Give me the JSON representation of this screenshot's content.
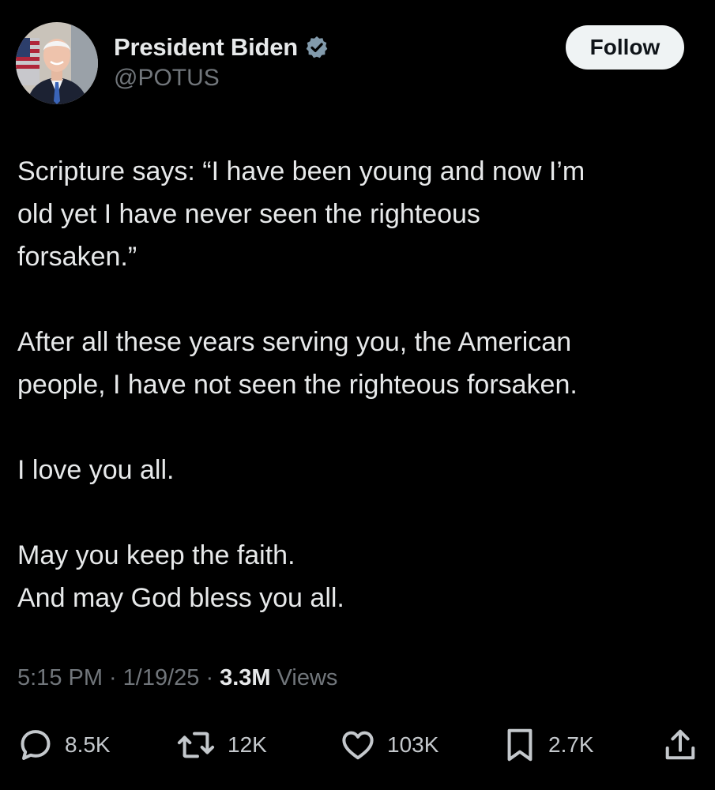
{
  "author": {
    "display_name": "President Biden",
    "handle": "@POTUS",
    "verified": true,
    "verified_color": "#71767b",
    "avatar_icon": "portrait-avatar"
  },
  "follow_label": "Follow",
  "body": {
    "paragraphs": [
      "Scripture says: “I have been young and now I’m\nold yet I have never seen the righteous\nforsaken.”",
      "After all these years serving you, the American\npeople, I have not seen the righteous forsaken.",
      "I love you all.",
      "May you keep the faith.\nAnd may God bless you all."
    ]
  },
  "meta": {
    "time": "5:15 PM",
    "separator": "·",
    "date": "1/19/25",
    "views_count": "3.3M",
    "views_label": "Views"
  },
  "actions": {
    "replies": "8.5K",
    "reposts": "12K",
    "likes": "103K",
    "bookmarks": "2.7K"
  },
  "colors": {
    "background": "#000000",
    "text_primary": "#e7e9ea",
    "text_secondary": "#71767b",
    "follow_button_bg": "#eff3f4"
  }
}
